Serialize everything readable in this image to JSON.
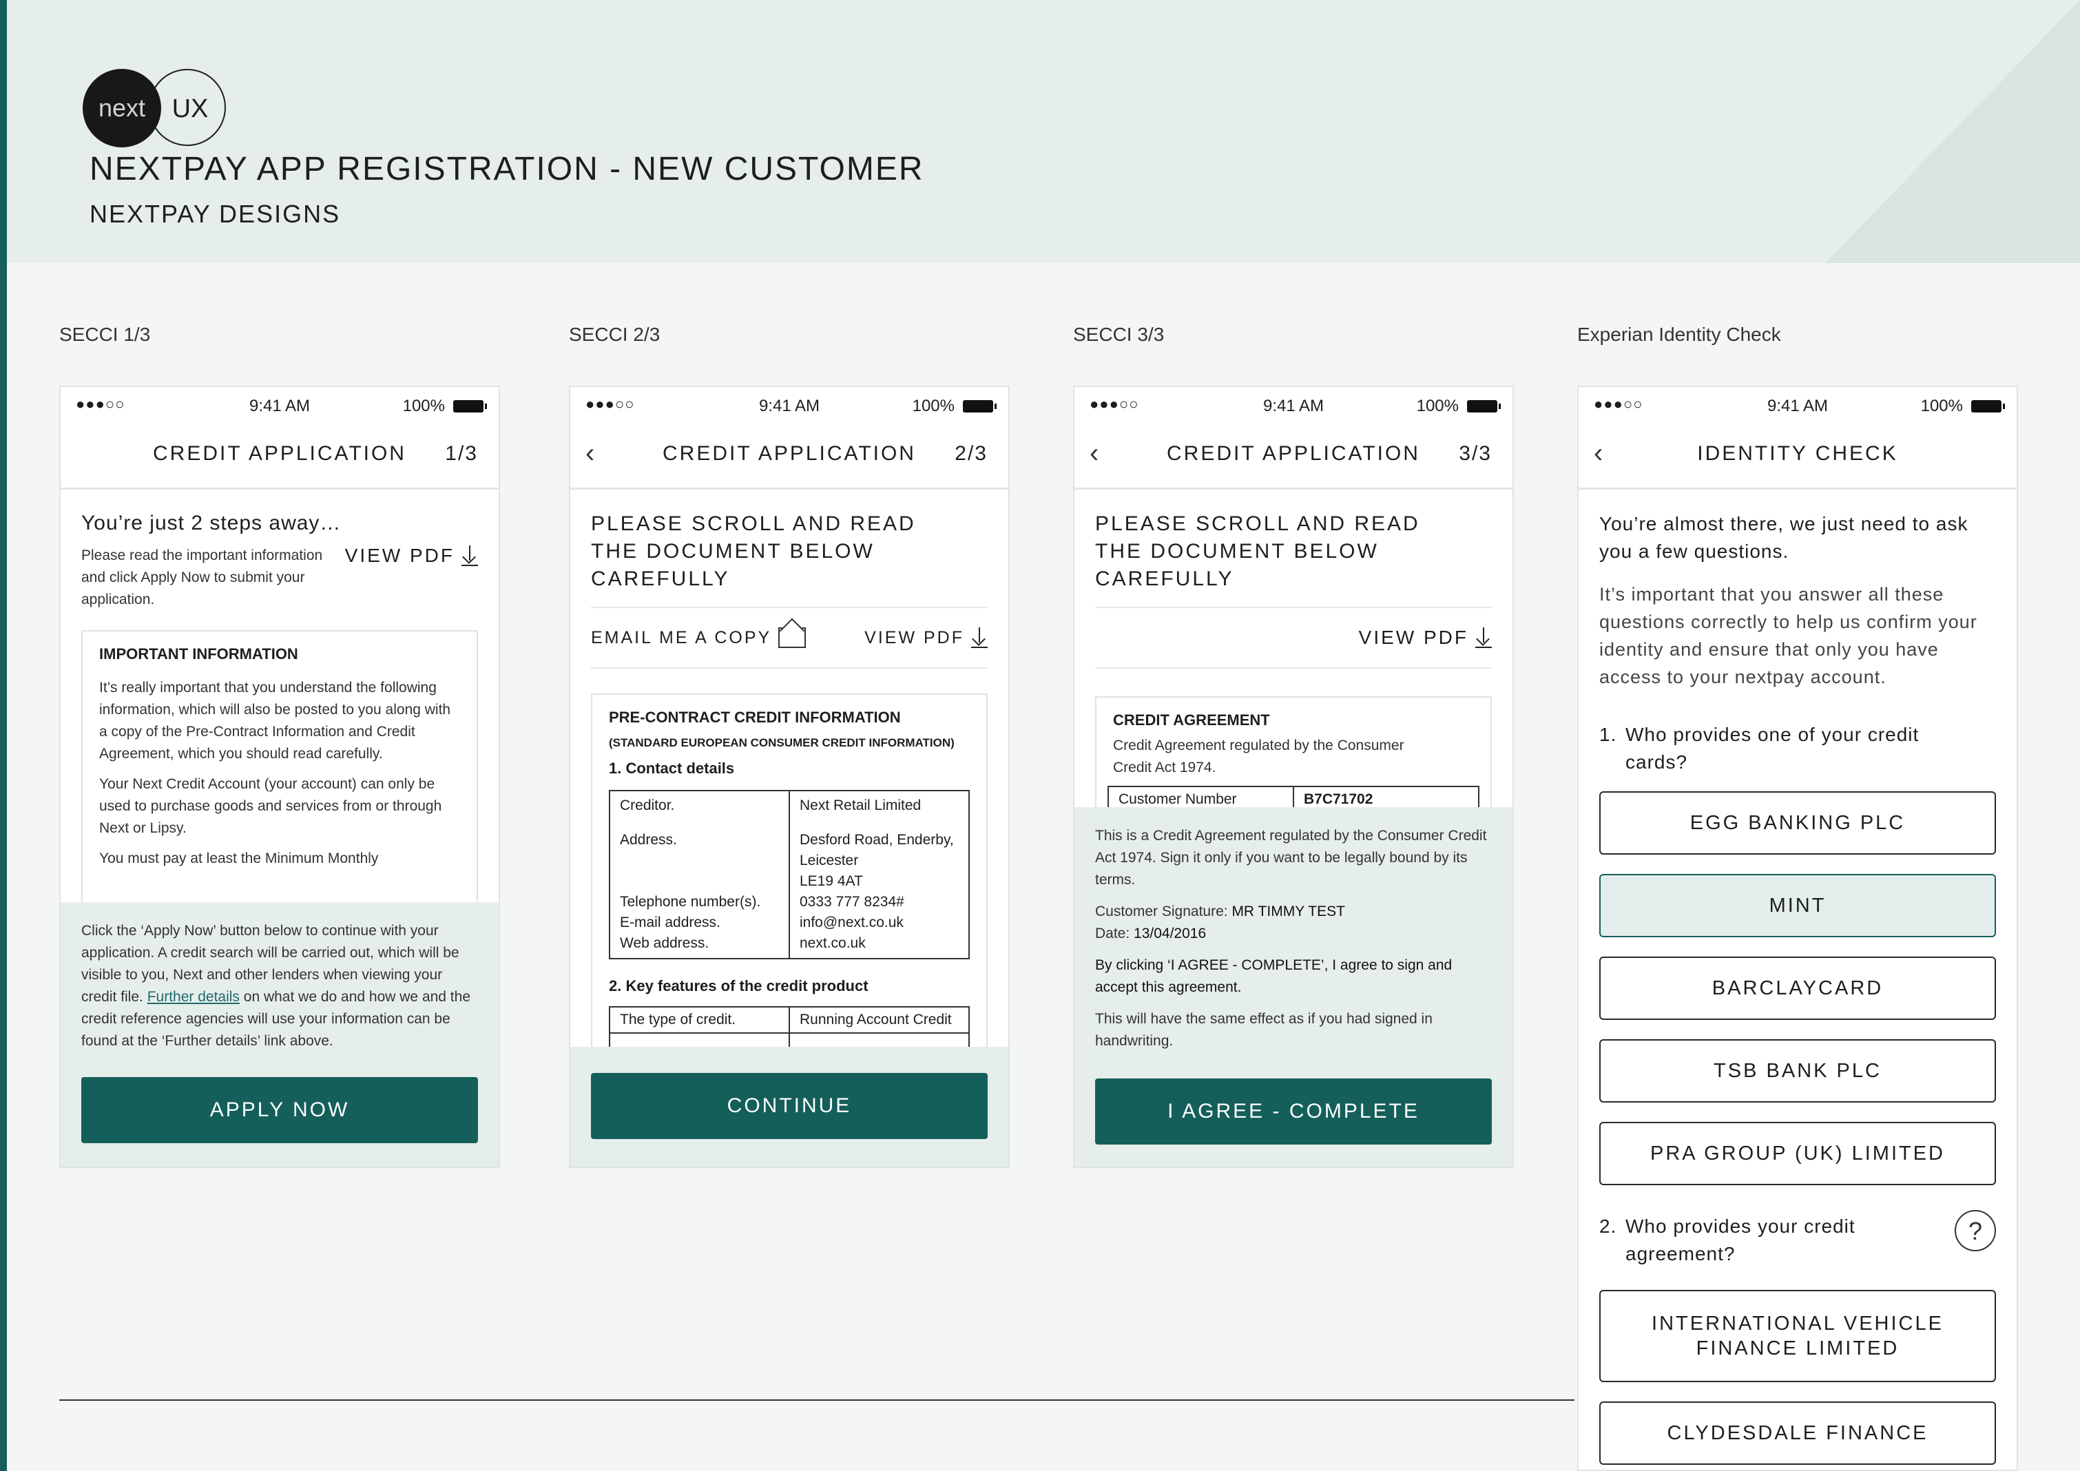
{
  "header": {
    "logo_left": "next",
    "logo_right": "UX",
    "title": "NEXTPAY APP REGISTRATION - NEW CUSTOMER",
    "subtitle": "NEXTPAY DESIGNS"
  },
  "status": {
    "signal": "●●●○○",
    "time": "9:41 AM",
    "battery": "100%"
  },
  "screens": [
    {
      "label": "SECCI 1/3",
      "nav_title": "CREDIT APPLICATION",
      "step": "1/3",
      "heading": "You’re just 2 steps away…",
      "intro": "Please read the important information and click Apply Now to submit your application.",
      "view_pdf": "VIEW PDF",
      "doc_title": "IMPORTANT INFORMATION",
      "doc_p1": "It’s really important that you understand the following information, which will also be posted to you along with a copy of the Pre-Contract Information and Credit Agreement, which you should read carefully.",
      "doc_p2": "Your Next Credit Account (your account) can only be used to purchase goods and services from or through Next or Lipsy.",
      "doc_p3": "You must pay at least the Minimum Monthly",
      "panel_text_a": "Click the ‘Apply Now’ button below to continue with your application. A credit search will be carried out, which will be visible to you, Next and other lenders when viewing your credit file. ",
      "panel_link": "Further details",
      "panel_text_b": " on what we do and how we and the credit reference agencies will use your information can be found at the ‘Further details’ link above.",
      "button": "APPLY NOW"
    },
    {
      "label": "SECCI 2/3",
      "nav_title": "CREDIT APPLICATION",
      "step": "2/3",
      "heading": "PLEASE SCROLL AND READ THE DOCUMENT BELOW CAREFULLY",
      "email_copy": "EMAIL ME A COPY",
      "view_pdf": "VIEW PDF",
      "doc_title": "PRE-CONTRACT CREDIT INFORMATION",
      "doc_subtitle": "(STANDARD EUROPEAN CONSUMER CREDIT INFORMATION)",
      "section1": "1. Contact details",
      "contact_labels": [
        "Creditor.",
        "Address.",
        "",
        "",
        "Telephone number(s).",
        "E-mail address.",
        "Web address."
      ],
      "contact_values": [
        "Next Retail Limited",
        "Desford Road, Enderby,",
        "Leicester",
        "LE19 4AT",
        "0333 777 8234#",
        "info@next.co.uk",
        "next.co.uk"
      ],
      "section2": "2. Key features of the credit product",
      "feature_label": "The type of credit.",
      "feature_value": "Running Account Credit",
      "button": "CONTINUE"
    },
    {
      "label": "SECCI 3/3",
      "nav_title": "CREDIT APPLICATION",
      "step": "3/3",
      "heading": "PLEASE SCROLL AND READ THE DOCUMENT BELOW CAREFULLY",
      "view_pdf": "VIEW PDF",
      "doc_title": "CREDIT AGREEMENT",
      "doc_p1": "Credit Agreement regulated by the Consumer Credit Act 1974.",
      "customer_number_label": "Customer Number",
      "customer_number": "B7C71702",
      "panel_p1": "This is a Credit Agreement regulated by the Consumer Credit Act 1974. Sign it only if you want to be legally bound by its terms.",
      "sig_label": "Customer Signature: ",
      "sig_value": "MR TIMMY TEST",
      "date_label": "Date: ",
      "date_value": "13/04/2016",
      "panel_p2": "By clicking ‘I AGREE - COMPLETE’, I agree to sign and accept this agreement.",
      "panel_p3": "This will have the same effect as if you had signed in handwriting.",
      "button": "I AGREE - COMPLETE"
    },
    {
      "label": "Experian Identity Check",
      "nav_title": "IDENTITY CHECK",
      "heading": "You’re almost there, we just need to ask you a few questions.",
      "intro": "It’s important that you answer all these questions correctly to help us confirm your identity and ensure that only you have access to your nextpay account.",
      "q1_num": "1.",
      "q1": "Who provides one of your credit cards?",
      "q1_options": [
        "EGG BANKING PLC",
        "MINT",
        "BARCLAYCARD",
        "TSB BANK PLC",
        "PRA GROUP (UK) LIMITED"
      ],
      "q1_selected": "MINT",
      "q2_num": "2.",
      "q2": "Who provides your credit agreement?",
      "help": "?",
      "q2_options": [
        "INTERNATIONAL VEHICLE FINANCE LIMITED",
        "CLYDESDALE FINANCE"
      ]
    }
  ],
  "colors": {
    "accent": "#145f5a",
    "header_bg": "#e6eeec",
    "page_bg": "#f3f6f5",
    "selected_bg": "#e3edeb"
  }
}
